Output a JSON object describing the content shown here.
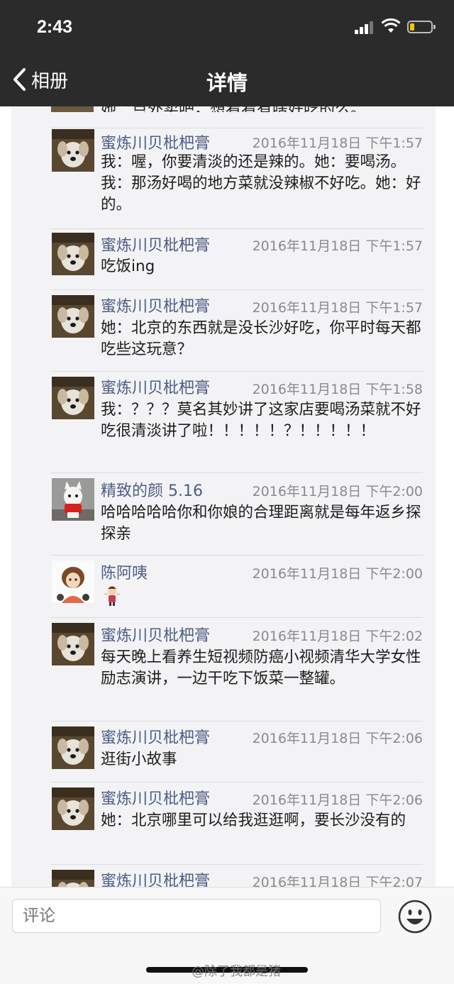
{
  "status_bar": {
    "time": "2:43"
  },
  "nav": {
    "back_label": "相册",
    "title": "详情"
  },
  "partial_top_comment": {
    "text": "她：点外卖吧，想看看有啥好吃的么。"
  },
  "comments": [
    {
      "name": "蜜炼川贝枇杷膏",
      "time": "2016年11月18日 下午1:57",
      "text": "我：喔，你要清淡的还是辣的。她：要喝汤。我：那汤好喝的地方菜就没辣椒不好吃。她：好的。",
      "avatar": "dog-avatar"
    },
    {
      "name": "蜜炼川贝枇杷膏",
      "time": "2016年11月18日 下午1:57",
      "text": "吃饭ing",
      "avatar": "dog-avatar"
    },
    {
      "name": "蜜炼川贝枇杷膏",
      "time": "2016年11月18日 下午1:57",
      "text": "她：北京的东西就是没长沙好吃，你平时每天都吃些这玩意？",
      "avatar": "dog-avatar"
    },
    {
      "name": "蜜炼川贝枇杷膏",
      "time": "2016年11月18日 下午1:58",
      "text": "我：？？？莫名其妙讲了这家店要喝汤菜就不好吃很清淡讲了啦！！！！！？！！！！！",
      "avatar": "dog-avatar"
    },
    {
      "name": "精致的颜 5.16",
      "time": "2016年11月18日 下午2:00",
      "text": "哈哈哈哈哈你和你娘的合理距离就是每年返乡探探亲",
      "avatar": "white-dog-avatar"
    },
    {
      "name": "陈阿咦",
      "time": "2016年11月18日 下午2:00",
      "text": "",
      "avatar": "cartoon-avatar"
    },
    {
      "name": "蜜炼川贝枇杷膏",
      "time": "2016年11月18日 下午2:02",
      "text": "每天晚上看养生短视频防癌小视频清华大学女性励志演讲，一边干吃下饭菜一整罐。",
      "avatar": "dog-avatar"
    },
    {
      "name": "蜜炼川贝枇杷膏",
      "time": "2016年11月18日 下午2:06",
      "text": "逛街小故事",
      "avatar": "dog-avatar"
    },
    {
      "name": "蜜炼川贝枇杷膏",
      "time": "2016年11月18日 下午2:06",
      "text": "她：北京哪里可以给我逛逛啊，要长沙没有的",
      "avatar": "dog-avatar"
    },
    {
      "name": "蜜炼川贝枇杷膏",
      "time": "2016年11月18日 下午2:07",
      "text": "",
      "avatar": "dog-avatar"
    }
  ],
  "input": {
    "placeholder": "评论"
  },
  "watermark": "@除了我都是猪",
  "colors": {
    "header_bg": "#2b2b2b",
    "name_color": "#4e5d86",
    "feed_bg": "#f3f3f5"
  }
}
